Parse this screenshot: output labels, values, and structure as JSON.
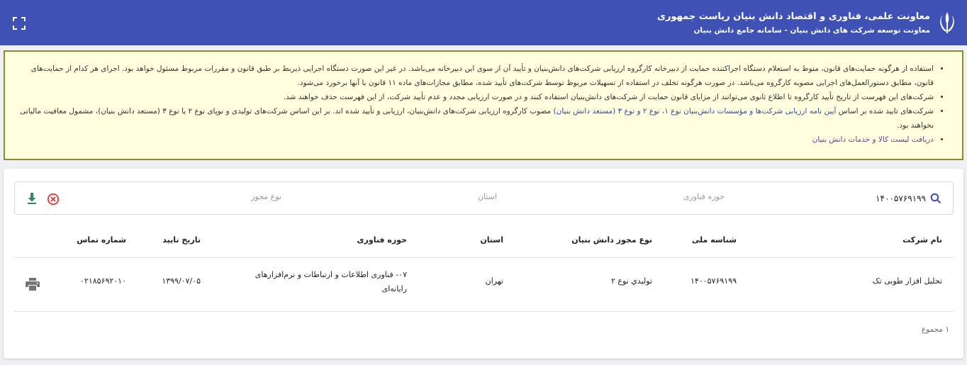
{
  "header": {
    "title": "معاونت علمی، فناوری و اقتصاد دانش بنیان ریاست جمهوری",
    "subtitle": "معاونت توسعه شرکت های دانش بنیان - سامانه جامع دانش بنیان"
  },
  "notice": {
    "item1": "استفاده از هرگونه حمایت‌های قانون، منوط به استعلام دستگاه اجراکننده حمایت از دبیرخانه کارگروه ارزیابی شرکت‌های دانش‌بنیان و تأیید آن از سوی این دبیرخانه می‌باشد. در غیر این صورت دستگاه اجرایی ذیربط بر طبق قانون و مقررات مربوط مسئول خواهد بود. اجرای هر کدام از حمایت‌های قانون، مطابق دستورالعمل‌های اجرایی مصوبه کارگروه می‌باشد. در صورت هرگونه تخلف در استفاده از تسهیلات مربوط توسط شرکت‌های تأیید شده، مطابق مجازات‌های ماده ۱۱ قانون با آنها برخورد می‌شود.",
    "item2": "شرکت‌های این فهرست از تاریخ تأیید کارگروه تا اطلاع ثانوی می‌توانند از مزایای قانون حمایت از شرکت‌های دانش‌بنیان استفاده کنند و در صورت ارزیابی مجدد و عدم تأیید شرکت، از این فهرست حذف خواهند شد.",
    "item3_before": "شرکت‌های تایید شده بر اساس ",
    "item3_link": "آیین نامه ارزیابی شرکت‌ها و مؤسسات دانش‌بنیان نوع ۱، نوع ۲ و نوع ۳ (مستعد دانش بنیان)",
    "item3_after": " مصوب کارگروه ارزیابی شرکت‌های دانش‌بنیان، ارزیابی و تأیید شده اند. بر این اساس شرکت‌های تولیدی و نوپای نوع ۲ یا نوع ۳ (مستعد دانش بنیان)، مشمول معافیت مالیاتی نخواهند بود.",
    "item4_link": "دریافت لیست کالا و خدمات دانش بنیان"
  },
  "search": {
    "value": "۱۴۰۰۵۷۶۹۱۹۹",
    "tech_placeholder": "حوزه فناوری",
    "province_placeholder": "استان",
    "license_placeholder": "نوع مجوز"
  },
  "table": {
    "headers": {
      "name": "نام شرکت",
      "national_id": "شناسه ملی",
      "license": "نوع مجوز دانش بنیان",
      "province": "استان",
      "tech": "حوزه فناوری",
      "date": "تاریخ تایید",
      "phone": "شماره تماس"
    },
    "rows": [
      {
        "name": "تحلیل افزار طوبی تک",
        "national_id": "۱۴۰۰۵۷۶۹۱۹۹",
        "license": "توليدي نوع ۲",
        "province": "تهران",
        "tech": "۰۷- فناوری اطلاعات و ارتباطات و نرم‌افزارهای رایانه‌ای",
        "date": "۱۳۹۹/۰۷/۰۵",
        "phone": "۰۲۱۸۵۶۹۲۰۱۰"
      }
    ]
  },
  "footer": {
    "total": "۱ مجموع"
  },
  "colors": {
    "header_bg": "#3f51b5",
    "notice_bg": "#ffffe0",
    "clear_red": "#e53935",
    "download_green": "#2e8b57"
  },
  "icons": {
    "emblem": "iran-emblem-icon",
    "fullscreen": "fullscreen-icon",
    "search": "search-icon",
    "clear": "clear-icon",
    "download": "download-icon",
    "print": "print-icon"
  }
}
